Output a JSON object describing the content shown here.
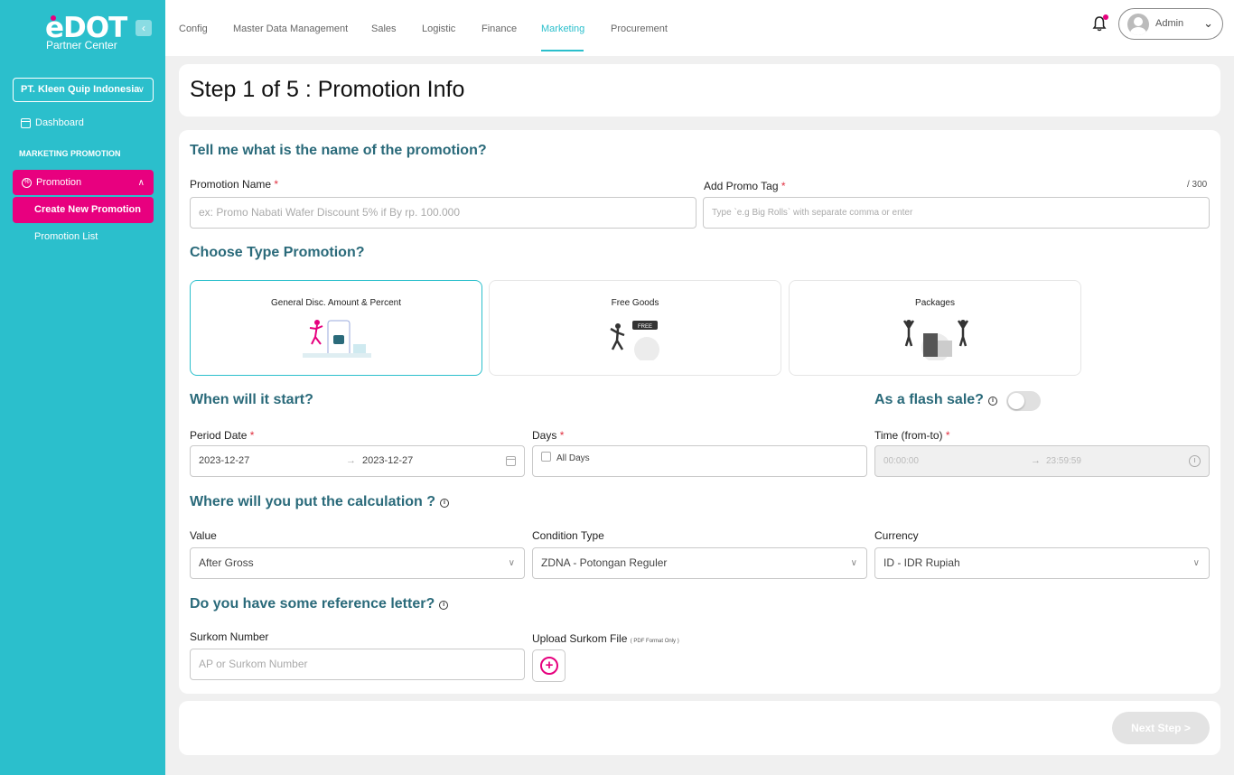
{
  "brand": {
    "name": "eDOT",
    "subtitle": "Partner Center"
  },
  "sidebar": {
    "company": "PT. Kleen Quip Indonesia",
    "dashboard_label": "Dashboard",
    "section_title": "MARKETING PROMOTION",
    "promotion_label": "Promotion",
    "sub_items": [
      "Create New Promotion",
      "Promotion List"
    ]
  },
  "topnav": {
    "items": [
      "Config",
      "Master Data Management",
      "Sales",
      "Logistic",
      "Finance",
      "Marketing",
      "Procurement"
    ],
    "active": "Marketing",
    "user": "Admin"
  },
  "page": {
    "title": "Step 1 of 5 : Promotion Info"
  },
  "form": {
    "q_name": "Tell me what is the name of the promotion?",
    "promotion_name": {
      "label": "Promotion Name",
      "required": "*",
      "placeholder": "ex: Promo Nabati Wafer Discount 5% if By rp. 100.000"
    },
    "promo_tag": {
      "label": "Add Promo Tag",
      "required": "*",
      "placeholder": "Type `e.g Big Rolls` with separate comma or enter",
      "counter": "/ 300"
    },
    "q_type": "Choose Type Promotion?",
    "types": [
      "General Disc. Amount & Percent",
      "Free Goods",
      "Packages"
    ],
    "selected_type": "General Disc. Amount & Percent",
    "free_tag": "FREE",
    "q_start": "When will it start?",
    "q_flash": "As a flash sale?",
    "flash_sale_on": false,
    "period": {
      "label": "Period Date",
      "required": "*",
      "from": "2023-12-27",
      "to": "2023-12-27"
    },
    "days": {
      "label": "Days",
      "required": "*",
      "option": "All Days"
    },
    "time": {
      "label": "Time (from-to)",
      "required": "*",
      "from": "00:00:00",
      "to": "23:59:59"
    },
    "q_calc": "Where will you put the calculation ?",
    "value": {
      "label": "Value",
      "selected": "After Gross"
    },
    "condition_type": {
      "label": "Condition Type",
      "selected": "ZDNA - Potongan Reguler"
    },
    "currency": {
      "label": "Currency",
      "selected": "ID - IDR Rupiah"
    },
    "q_ref": "Do you have some reference letter?",
    "surkom_number": {
      "label": "Surkom Number",
      "placeholder": "AP or Surkom Number"
    },
    "upload": {
      "label": "Upload Surkom File",
      "note": "( PDF Format Only )"
    }
  },
  "footer": {
    "next_label": "Next Step >"
  },
  "colors": {
    "primary": "#2bbfcc",
    "accent": "#e8007f",
    "heading": "#2a6a7a"
  }
}
